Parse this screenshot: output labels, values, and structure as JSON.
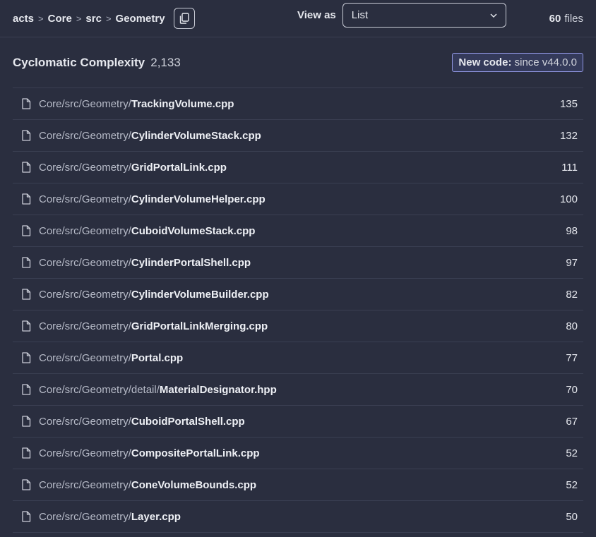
{
  "breadcrumb": [
    "acts",
    "Core",
    "src",
    "Geometry"
  ],
  "view_as": {
    "label": "View as",
    "selected": "List"
  },
  "files_count": {
    "number": "60",
    "suffix": "files"
  },
  "metric": {
    "title": "Cyclomatic Complexity",
    "value": "2,133"
  },
  "new_code": {
    "label": "New code:",
    "text": "since v44.0.0"
  },
  "rows": [
    {
      "dir": "Core/src/Geometry/",
      "file": "TrackingVolume.cpp",
      "value": "135"
    },
    {
      "dir": "Core/src/Geometry/",
      "file": "CylinderVolumeStack.cpp",
      "value": "132"
    },
    {
      "dir": "Core/src/Geometry/",
      "file": "GridPortalLink.cpp",
      "value": "111"
    },
    {
      "dir": "Core/src/Geometry/",
      "file": "CylinderVolumeHelper.cpp",
      "value": "100"
    },
    {
      "dir": "Core/src/Geometry/",
      "file": "CuboidVolumeStack.cpp",
      "value": "98"
    },
    {
      "dir": "Core/src/Geometry/",
      "file": "CylinderPortalShell.cpp",
      "value": "97"
    },
    {
      "dir": "Core/src/Geometry/",
      "file": "CylinderVolumeBuilder.cpp",
      "value": "82"
    },
    {
      "dir": "Core/src/Geometry/",
      "file": "GridPortalLinkMerging.cpp",
      "value": "80"
    },
    {
      "dir": "Core/src/Geometry/",
      "file": "Portal.cpp",
      "value": "77"
    },
    {
      "dir": "Core/src/Geometry/detail/",
      "file": "MaterialDesignator.hpp",
      "value": "70"
    },
    {
      "dir": "Core/src/Geometry/",
      "file": "CuboidPortalShell.cpp",
      "value": "67"
    },
    {
      "dir": "Core/src/Geometry/",
      "file": "CompositePortalLink.cpp",
      "value": "52"
    },
    {
      "dir": "Core/src/Geometry/",
      "file": "ConeVolumeBounds.cpp",
      "value": "52"
    },
    {
      "dir": "Core/src/Geometry/",
      "file": "Layer.cpp",
      "value": "50"
    }
  ]
}
